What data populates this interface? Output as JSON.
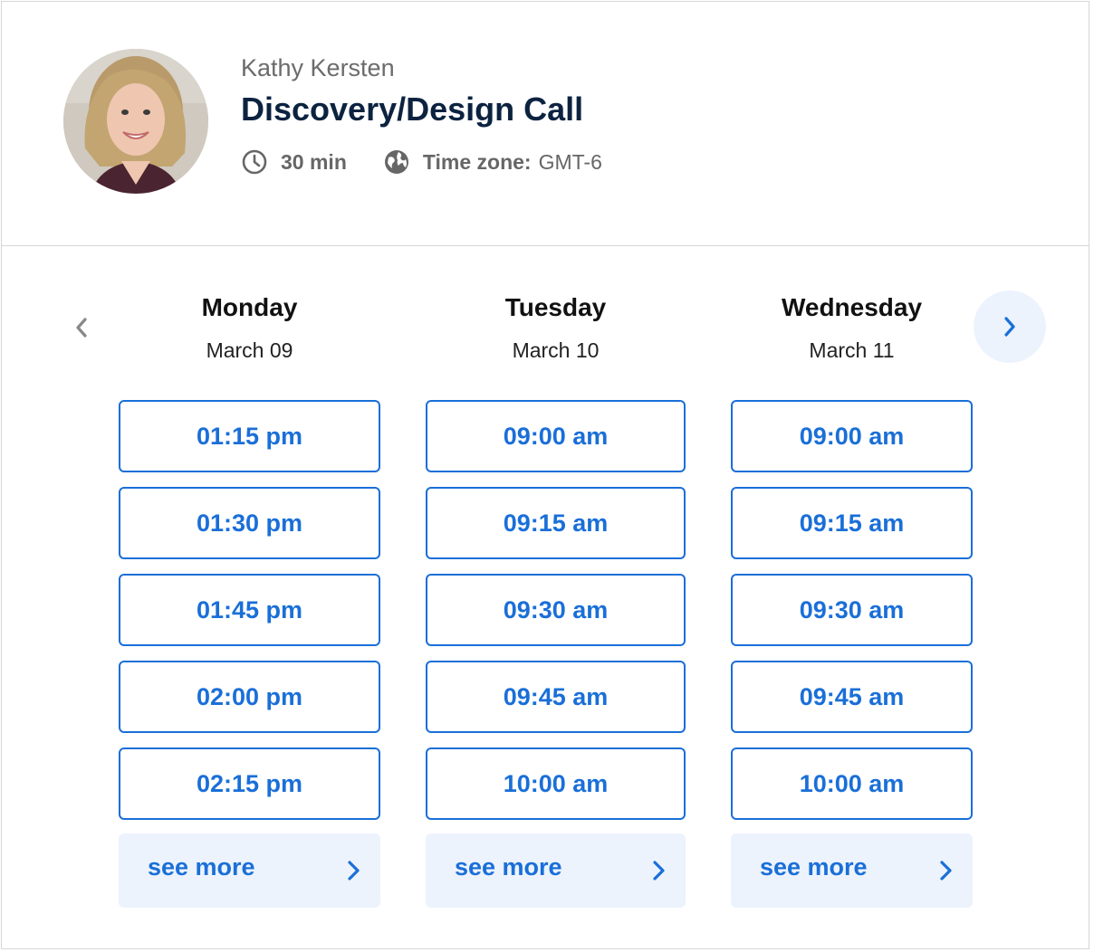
{
  "header": {
    "host_name": "Kathy Kersten",
    "event_title": "Discovery/Design Call",
    "duration": "30 min",
    "timezone_label": "Time zone:",
    "timezone_value": "GMT-6",
    "duration_icon": "clock-icon",
    "timezone_icon": "globe-icon"
  },
  "navigation": {
    "prev_icon": "chevron-left-icon",
    "next_icon": "chevron-right-icon"
  },
  "days": [
    {
      "name": "Monday",
      "date": "March 09",
      "slots": [
        "01:15 pm",
        "01:30 pm",
        "01:45 pm",
        "02:00 pm",
        "02:15 pm"
      ],
      "see_more": "see more"
    },
    {
      "name": "Tuesday",
      "date": "March 10",
      "slots": [
        "09:00 am",
        "09:15 am",
        "09:30 am",
        "09:45 am",
        "10:00 am"
      ],
      "see_more": "see more"
    },
    {
      "name": "Wednesday",
      "date": "March 11",
      "slots": [
        "09:00 am",
        "09:15 am",
        "09:30 am",
        "09:45 am",
        "10:00 am"
      ],
      "see_more": "see more"
    }
  ],
  "colors": {
    "accent": "#1a6fd8",
    "accent_light": "#ecf3fd",
    "title": "#0c2340"
  }
}
